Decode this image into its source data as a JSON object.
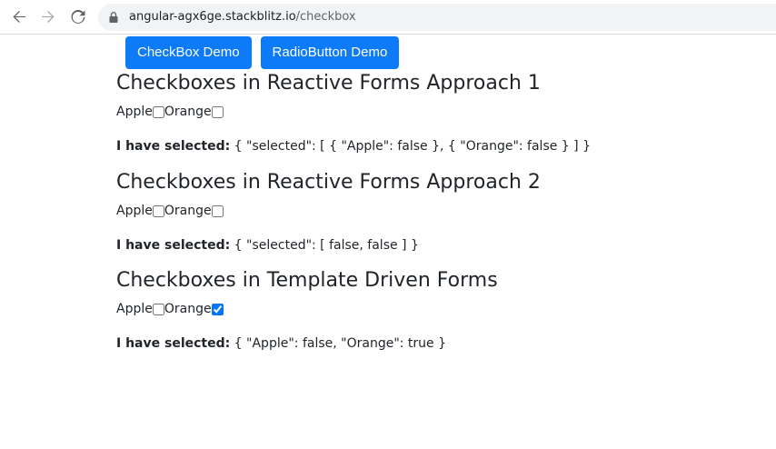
{
  "browser": {
    "url_host": "angular-agx6ge.stackblitz.io",
    "url_path": "/checkbox"
  },
  "buttons": {
    "checkbox_demo": "CheckBox Demo",
    "radiobutton_demo": "RadioButton Demo"
  },
  "sections": [
    {
      "title": "Checkboxes in Reactive Forms Approach 1",
      "options": [
        {
          "label": "Apple",
          "checked": false
        },
        {
          "label": "Orange",
          "checked": false
        }
      ],
      "selected_label": "I have selected:",
      "selected_value": " { \"selected\": [ { \"Apple\": false }, { \"Orange\": false } ] }"
    },
    {
      "title": "Checkboxes in Reactive Forms Approach 2",
      "options": [
        {
          "label": "Apple",
          "checked": false
        },
        {
          "label": "Orange",
          "checked": false
        }
      ],
      "selected_label": "I have selected:",
      "selected_value": " { \"selected\": [ false, false ] }"
    },
    {
      "title": "Checkboxes in Template Driven Forms",
      "options": [
        {
          "label": "Apple",
          "checked": false
        },
        {
          "label": "Orange",
          "checked": true
        }
      ],
      "selected_label": "I have selected:",
      "selected_value": " { \"Apple\": false, \"Orange\": true }"
    }
  ],
  "colors": {
    "primary_button": "#0d7bf8",
    "text": "#212529"
  },
  "icons": [
    "back-arrow-icon",
    "forward-arrow-icon",
    "reload-icon",
    "lock-icon"
  ]
}
